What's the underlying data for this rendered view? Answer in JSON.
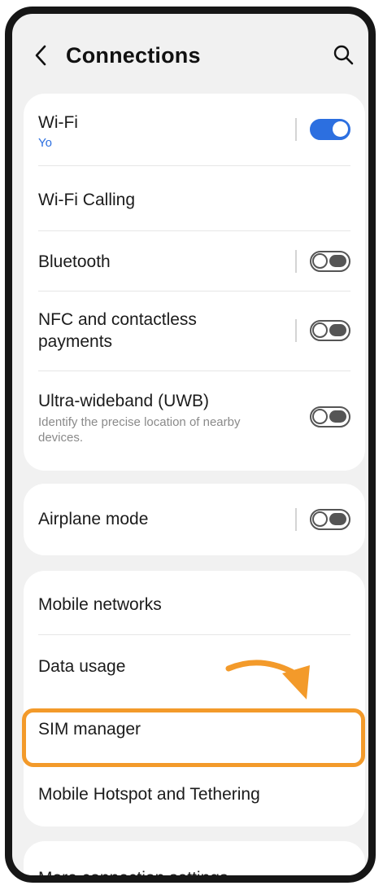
{
  "header": {
    "title": "Connections",
    "back_icon": "chevron-left-icon",
    "search_icon": "search-icon"
  },
  "sections": {
    "wireless": {
      "wifi": {
        "label": "Wi-Fi",
        "sub": "Yo",
        "toggle": "on"
      },
      "wifi_calling": {
        "label": "Wi-Fi Calling"
      },
      "bluetooth": {
        "label": "Bluetooth",
        "toggle": "off"
      },
      "nfc": {
        "label_line1": "NFC and contactless",
        "label_line2": "payments",
        "toggle": "off"
      },
      "uwb": {
        "label": "Ultra-wideband (UWB)",
        "sub_line1": "Identify the precise location of nearby",
        "sub_line2": "devices.",
        "toggle": "off"
      }
    },
    "airplane": {
      "airplane_mode": {
        "label": "Airplane mode",
        "toggle": "off"
      }
    },
    "mobile": {
      "mobile_networks": {
        "label": "Mobile networks"
      },
      "data_usage": {
        "label": "Data usage"
      },
      "sim_manager": {
        "label": "SIM manager"
      },
      "hotspot": {
        "label": "Mobile Hotspot and Tethering"
      }
    },
    "more": {
      "more_settings": {
        "label": "More connection settings"
      }
    }
  },
  "colors": {
    "accent": "#2c6fe0",
    "highlight": "#f39a2a",
    "background": "#f1f1f1",
    "card": "#ffffff"
  }
}
